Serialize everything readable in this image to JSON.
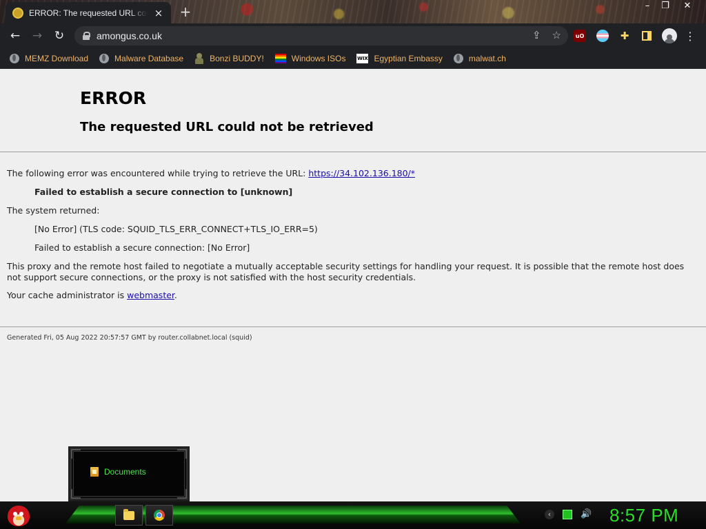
{
  "browser": {
    "tab": {
      "title": "ERROR: The requested URL could not be retrieved",
      "close_label": "×"
    },
    "new_tab_label": "+",
    "window_controls": {
      "minimize": "–",
      "restore": "❐",
      "close": "✕"
    },
    "address": "amongus.co.uk",
    "nav": {
      "back": "←",
      "forward": "→",
      "reload": "↻"
    },
    "omnibox_icons": {
      "share": "⇪",
      "bookmark": "☆"
    },
    "extensions": {
      "ublock_label": "uO",
      "menu": "⋮",
      "puzzle": "✚"
    },
    "bookmarks": [
      {
        "label": "MEMZ Download",
        "icon": "globe-icon"
      },
      {
        "label": "Malware Database",
        "icon": "globe-icon"
      },
      {
        "label": "Bonzi BUDDY!",
        "icon": "bonzi-icon"
      },
      {
        "label": "Windows ISOs",
        "icon": "rainbow-icon"
      },
      {
        "label": "Egyptian Embassy",
        "icon": "wix-icon",
        "icon_text": "WIX"
      },
      {
        "label": "malwat.ch",
        "icon": "globe-icon"
      }
    ]
  },
  "page": {
    "title": "ERROR",
    "subtitle": "The requested URL could not be retrieved",
    "encountered_text": "The following error was encountered while trying to retrieve the URL: ",
    "encountered_url": "https://34.102.136.180/*",
    "failed_secure": "Failed to establish a secure connection to [unknown]",
    "system_returned": "The system returned:",
    "tls_code": "[No Error] (TLS code: SQUID_TLS_ERR_CONNECT+TLS_IO_ERR=5)",
    "failed_secure_no_error": "Failed to establish a secure connection: [No Error]",
    "explanation": "This proxy and the remote host failed to negotiate a mutually acceptable security settings for handling your request. It is possible that the remote host does not support secure connections, or the proxy is not satisfied with the host security credentials.",
    "admin_prefix": "Your cache administrator is ",
    "admin_link": "webmaster",
    "admin_suffix": ".",
    "generated": "Generated Fri, 05 Aug 2022 20:57:57 GMT by router.collabnet.local (squid)"
  },
  "desktop": {
    "documents_label": "Documents"
  },
  "taskbar": {
    "clock": "8:57 PM",
    "tray_arrow": "‹",
    "volume": "🔊"
  },
  "colors": {
    "bookmark_text": "#f0b56a",
    "link": "#1a0dab",
    "clock_green": "#2ddb2d",
    "chrome_dark": "#202124"
  }
}
